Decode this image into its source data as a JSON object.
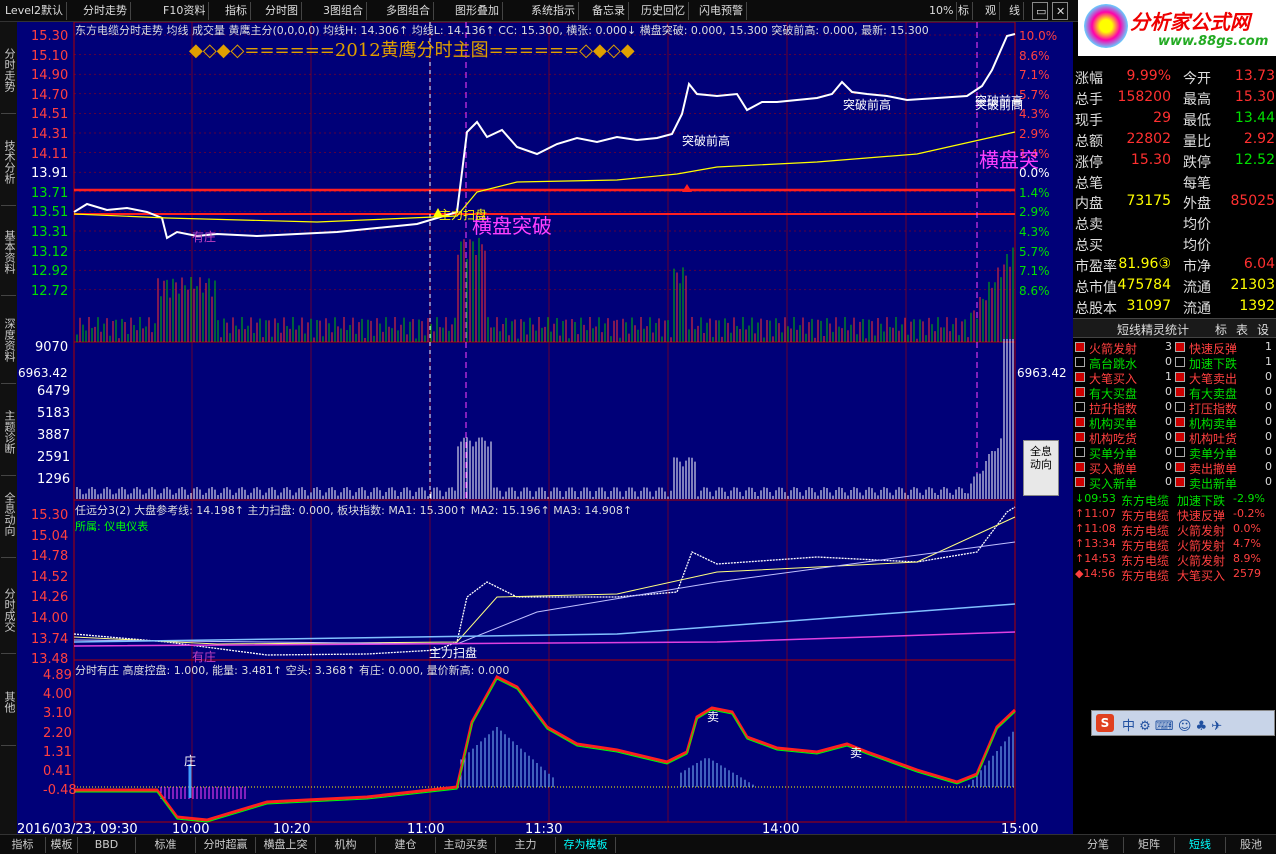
{
  "toolbar": {
    "items": [
      "Level2默认",
      "分时走势",
      "F10资料",
      "指标",
      "分时图",
      "3图组合",
      "多图组合",
      "图形叠加",
      "系统指示",
      "备忘录",
      "历史回忆",
      "闪电预警"
    ],
    "right": [
      "10%",
      "标",
      "观",
      "线"
    ],
    "logo_text": "分析家公式网",
    "logo_url": "www.88gs.com"
  },
  "left_nav": [
    "分时走势",
    "技术分析",
    "基本资料",
    "深度资料",
    "主题诊断",
    "全息动向",
    "分时成交",
    "其他"
  ],
  "price_panel": {
    "header": "东方电缆分时走势  均线  成交量  黄鹰主分(0,0,0,0)  均线H: 14.306↑  均线L: 14.136↑  CC: 15.300, 横张: 0.000↓  横盘突破: 0.000, 15.300  突破前高: 0.000, 最新: 15.300",
    "banner": "◆◇◆◇======2012黄鹰分时主图======◇◆◇◆",
    "left_ticks": [
      "15.30",
      "15.10",
      "14.90",
      "14.70",
      "14.51",
      "14.31",
      "14.11",
      "13.91",
      "13.71",
      "13.51",
      "13.31",
      "13.12",
      "12.92",
      "12.72"
    ],
    "right_ticks": [
      "10.0%",
      "8.6%",
      "7.1%",
      "5.7%",
      "4.3%",
      "2.9%",
      "1.4%",
      "0.0%",
      "1.4%",
      "2.9%",
      "4.3%",
      "5.7%",
      "7.1%",
      "8.6%"
    ],
    "annotations": [
      "突破前高",
      "突破前高",
      "突破前高",
      "突破前高",
      "横盘突破",
      "横盘突",
      "主力扫盘",
      "有庄"
    ]
  },
  "volume_panel": {
    "label_top": "9070",
    "ticks": [
      "6479",
      "5183",
      "3887",
      "2591",
      "1296"
    ],
    "value_left": "6963.42",
    "value_right": "6963.42"
  },
  "panel3": {
    "header": "任远分3(2)  大盘参考线: 14.198↑  主力扫盘: 0.000, 板块指数: MA1: 15.300↑  MA2: 15.196↑  MA3: 14.908↑",
    "sub": "所属: 仪电仪表",
    "ticks": [
      "15.30",
      "15.04",
      "14.78",
      "14.52",
      "14.26",
      "14.00",
      "13.74",
      "13.48"
    ],
    "annotations": [
      "主力扫盘",
      "有庄"
    ]
  },
  "panel4": {
    "header": "分时有庄  高度控盘: 1.000, 能量: 3.481↑  空头: 3.368↑  有庄: 0.000,  量价新高: 0.000",
    "ticks": [
      "4.89",
      "4.00",
      "3.10",
      "2.20",
      "1.31",
      "0.41",
      "-0.48"
    ],
    "annotations": [
      "庄",
      "卖",
      "卖"
    ]
  },
  "time_axis": [
    "2016/03/23, 09:30",
    "10:00",
    "10:20",
    "11:00",
    "11:30",
    "14:00",
    "15:00"
  ],
  "quote": [
    {
      "l": "涨幅",
      "v": "9.99%",
      "l2": "今开",
      "v2": "13.73"
    },
    {
      "l": "总手",
      "v": "158200",
      "l2": "最高",
      "v2": "15.30"
    },
    {
      "l": "现手",
      "v": "29",
      "l2": "最低",
      "v2": "13.44"
    },
    {
      "l": "总额",
      "v": "22802",
      "l2": "量比",
      "v2": "2.92"
    },
    {
      "l": "涨停",
      "v": "15.30",
      "l2": "跌停",
      "v2": "12.52"
    },
    {
      "l": "总笔",
      "v": "",
      "l2": "每笔",
      "v2": ""
    },
    {
      "l": "内盘",
      "v": "73175",
      "l2": "外盘",
      "v2": "85025"
    },
    {
      "l": "总卖",
      "v": "",
      "l2": "均价",
      "v2": ""
    },
    {
      "l": "总买",
      "v": "",
      "l2": "均价",
      "v2": ""
    },
    {
      "l": "市盈率",
      "v": "81.96③",
      "l2": "市净",
      "v2": "6.04"
    },
    {
      "l": "总市值",
      "v": "475784",
      "l2": "流通",
      "v2": "21303"
    },
    {
      "l": "总股本",
      "v": "31097",
      "l2": "流通",
      "v2": "1392"
    }
  ],
  "sprite_title": "短线精灵统计",
  "sprite_tabs": [
    "标",
    "表",
    "设"
  ],
  "sprite_grid": [
    [
      "火箭发射",
      "3",
      "快速反弹",
      "1"
    ],
    [
      "高台跳水",
      "0",
      "加速下跌",
      "1"
    ],
    [
      "大笔买入",
      "1",
      "大笔卖出",
      "0"
    ],
    [
      "有大买盘",
      "0",
      "有大卖盘",
      "0"
    ],
    [
      "拉升指数",
      "0",
      "打压指数",
      "0"
    ],
    [
      "机构买单",
      "0",
      "机构卖单",
      "0"
    ],
    [
      "机构吃货",
      "0",
      "机构吐货",
      "0"
    ],
    [
      "买单分单",
      "0",
      "卖单分单",
      "0"
    ],
    [
      "买入撤单",
      "0",
      "卖出撤单",
      "0"
    ],
    [
      "买入新单",
      "0",
      "卖出新单",
      "0"
    ]
  ],
  "events": [
    {
      "t": "↓09:53",
      "n": "东方电缆",
      "e": "加速下跌",
      "v": "-2.9%"
    },
    {
      "t": "↑11:07",
      "n": "东方电缆",
      "e": "快速反弹",
      "v": "-0.2%"
    },
    {
      "t": "↑11:08",
      "n": "东方电缆",
      "e": "火箭发射",
      "v": "0.0%"
    },
    {
      "t": "↑13:34",
      "n": "东方电缆",
      "e": "火箭发射",
      "v": "4.7%"
    },
    {
      "t": "↑14:53",
      "n": "东方电缆",
      "e": "火箭发射",
      "v": "8.9%"
    },
    {
      "t": "◆14:56",
      "n": "东方电缆",
      "e": "大笔买入",
      "v": "2579"
    }
  ],
  "quanxi_label": "全息动向",
  "bottom_tabs": [
    "指标",
    "模板",
    "BBD",
    "标准",
    "分时超赢",
    "横盘上突",
    "机构",
    "建仓",
    "主动买卖",
    "主力",
    "存为模板"
  ],
  "bottom_right": [
    "分笔",
    "矩阵",
    "短线",
    "股池"
  ],
  "colors": {
    "up": "#ff3030",
    "down": "#00e000",
    "price": "#ffffff",
    "avg": "#ffff00",
    "bg": "#000078",
    "grid": "#b00000"
  }
}
